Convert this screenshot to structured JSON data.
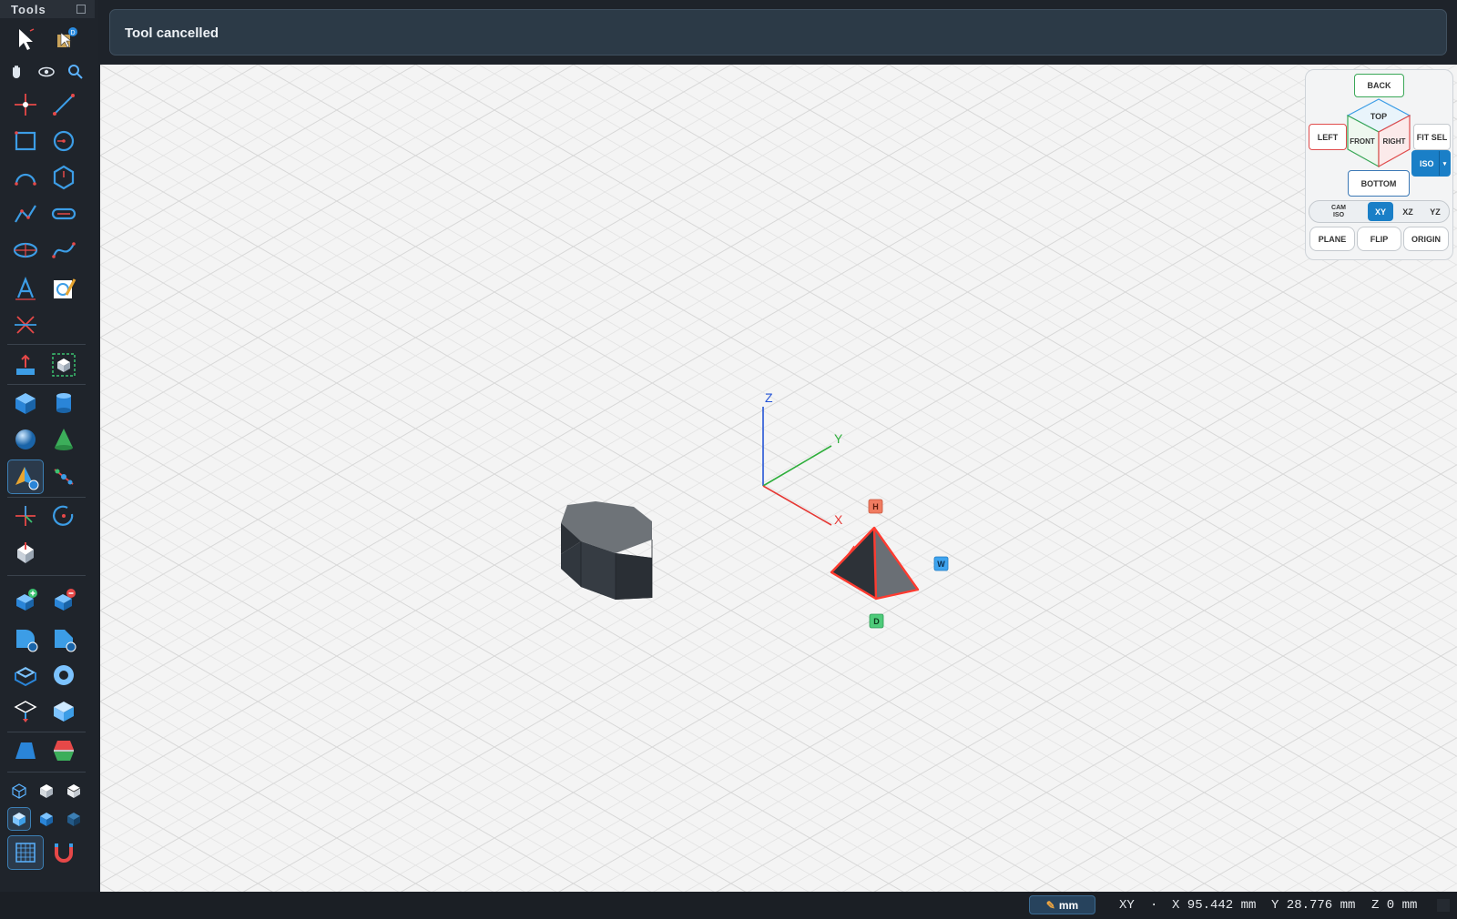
{
  "sidebar": {
    "title": "Tools",
    "tools": [
      "select-tool",
      "smart-select-tool",
      "pan-tool",
      "orbit-tool",
      "zoom-tool",
      "point-tool",
      "line-tool",
      "rectangle-tool",
      "circle-tool",
      "arc-tool",
      "polygon-tool",
      "polyline-tool",
      "slot-tool",
      "ellipse-tool",
      "spline-tool",
      "text-tool",
      "sketch-edit-tool",
      "trim-tool",
      "extrude-tool",
      "bounding-box-tool",
      "box-tool",
      "cylinder-tool",
      "sphere-tool",
      "cone-tool",
      "pyramid-tool",
      "measure-tool",
      "move-tool",
      "rotate-tool",
      "mirror-tool",
      "union-tool",
      "subtract-tool",
      "fillet-tool",
      "chamfer-tool",
      "shell-tool",
      "hole-tool",
      "section-tool",
      "plane-tool",
      "loft-tool",
      "draft-tool",
      "wireframe-view",
      "solid-view",
      "shaded-view",
      "xray-view",
      "flat-view",
      "dark-view",
      "grid-toggle",
      "magnet-snap"
    ]
  },
  "notification": {
    "message": "Tool cancelled"
  },
  "viewport": {
    "axes": {
      "x": "X",
      "y": "Y",
      "z": "Z"
    },
    "handles": {
      "height": "H",
      "width": "W",
      "depth": "D"
    },
    "colors": {
      "x_axis": "#e53935",
      "y_axis": "#2fae3c",
      "z_axis": "#2454d6",
      "selection": "#ff3b30",
      "solid": "#6e7378"
    }
  },
  "navcube": {
    "back": "BACK",
    "top": "TOP",
    "left": "LEFT",
    "front": "FRONT",
    "right": "RIGHT",
    "bottom": "BOTTOM",
    "fit_sel": "FIT SEL",
    "iso": "ISO",
    "cam_iso_1": "CAM",
    "cam_iso_2": "ISO",
    "planes": [
      "XY",
      "XZ",
      "YZ"
    ],
    "active_plane": "XY",
    "plane": "PLANE",
    "flip": "FLIP",
    "origin": "ORIGIN"
  },
  "status": {
    "unit": "mm",
    "plane": "XY",
    "dot": "·",
    "x": "X 95.442 mm",
    "y": "Y 28.776 mm",
    "z": "Z 0 mm"
  }
}
